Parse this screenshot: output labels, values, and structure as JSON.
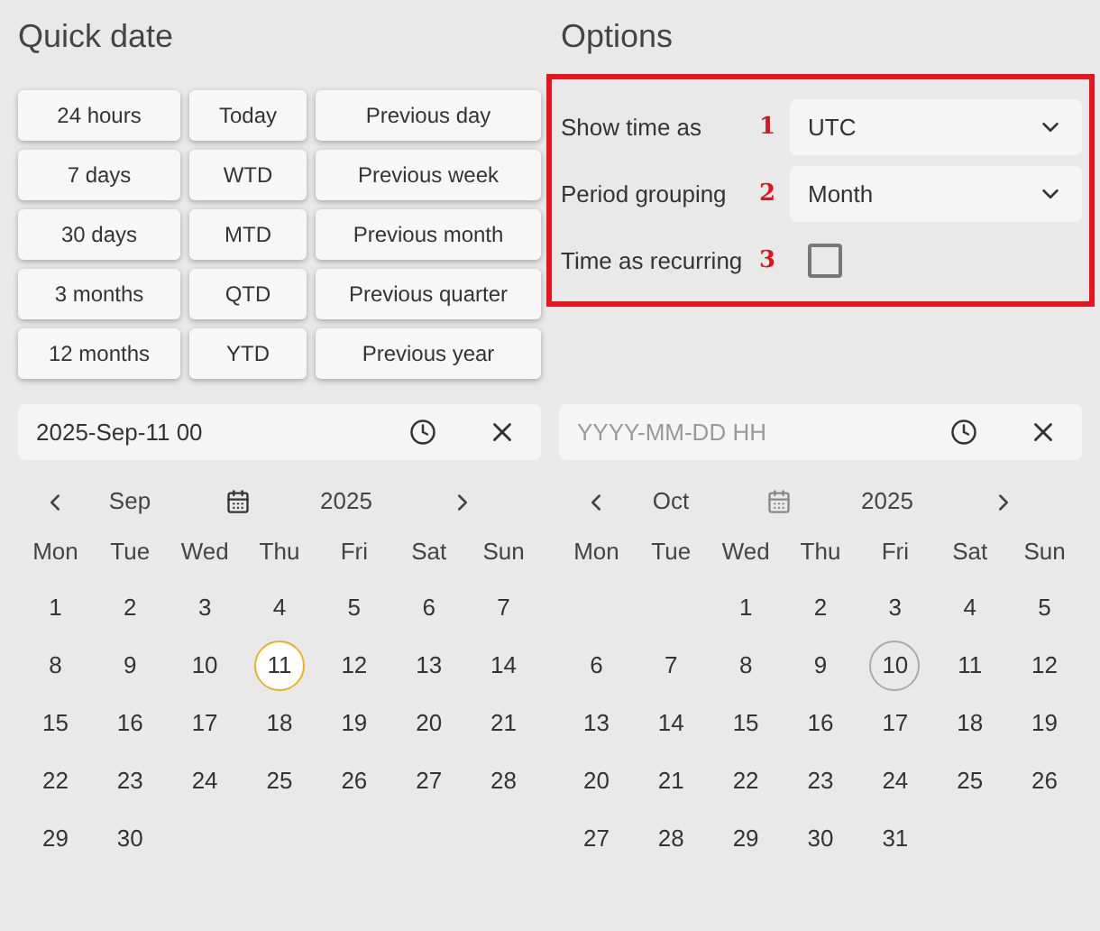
{
  "quick_date": {
    "title": "Quick date",
    "buttons": [
      {
        "label": "24 hours"
      },
      {
        "label": "Today"
      },
      {
        "label": "Previous day"
      },
      {
        "label": "7 days"
      },
      {
        "label": "WTD"
      },
      {
        "label": "Previous week"
      },
      {
        "label": "30 days"
      },
      {
        "label": "MTD"
      },
      {
        "label": "Previous month"
      },
      {
        "label": "3 months"
      },
      {
        "label": "QTD"
      },
      {
        "label": "Previous quarter"
      },
      {
        "label": "12 months"
      },
      {
        "label": "YTD"
      },
      {
        "label": "Previous year"
      }
    ]
  },
  "options": {
    "title": "Options",
    "rows": [
      {
        "kind": "select",
        "label": "Show time as",
        "annotation": "1",
        "value": "UTC"
      },
      {
        "kind": "select",
        "label": "Period grouping",
        "annotation": "2",
        "value": "Month"
      },
      {
        "kind": "checkbox",
        "label": "Time as recurring",
        "annotation": "3",
        "checked": false
      }
    ]
  },
  "calendars": [
    {
      "field": {
        "value": "2025-Sep-11 00"
      },
      "month": "Sep",
      "year": "2025",
      "weekdays": [
        "Mon",
        "Tue",
        "Wed",
        "Thu",
        "Fri",
        "Sat",
        "Sun"
      ],
      "days": [
        {
          "kind": "day",
          "label": "1",
          "selected": false,
          "today": false
        },
        {
          "kind": "day",
          "label": "2",
          "selected": false,
          "today": false
        },
        {
          "kind": "day",
          "label": "3",
          "selected": false,
          "today": false
        },
        {
          "kind": "day",
          "label": "4",
          "selected": false,
          "today": false
        },
        {
          "kind": "day",
          "label": "5",
          "selected": false,
          "today": false
        },
        {
          "kind": "day",
          "label": "6",
          "selected": false,
          "today": false
        },
        {
          "kind": "day",
          "label": "7",
          "selected": false,
          "today": false
        },
        {
          "kind": "day",
          "label": "8",
          "selected": false,
          "today": false
        },
        {
          "kind": "day",
          "label": "9",
          "selected": false,
          "today": false
        },
        {
          "kind": "day",
          "label": "10",
          "selected": false,
          "today": false
        },
        {
          "kind": "day",
          "label": "11",
          "selected": true,
          "today": false
        },
        {
          "kind": "day",
          "label": "12",
          "selected": false,
          "today": false
        },
        {
          "kind": "day",
          "label": "13",
          "selected": false,
          "today": false
        },
        {
          "kind": "day",
          "label": "14",
          "selected": false,
          "today": false
        },
        {
          "kind": "day",
          "label": "15",
          "selected": false,
          "today": false
        },
        {
          "kind": "day",
          "label": "16",
          "selected": false,
          "today": false
        },
        {
          "kind": "day",
          "label": "17",
          "selected": false,
          "today": false
        },
        {
          "kind": "day",
          "label": "18",
          "selected": false,
          "today": false
        },
        {
          "kind": "day",
          "label": "19",
          "selected": false,
          "today": false
        },
        {
          "kind": "day",
          "label": "20",
          "selected": false,
          "today": false
        },
        {
          "kind": "day",
          "label": "21",
          "selected": false,
          "today": false
        },
        {
          "kind": "day",
          "label": "22",
          "selected": false,
          "today": false
        },
        {
          "kind": "day",
          "label": "23",
          "selected": false,
          "today": false
        },
        {
          "kind": "day",
          "label": "24",
          "selected": false,
          "today": false
        },
        {
          "kind": "day",
          "label": "25",
          "selected": false,
          "today": false
        },
        {
          "kind": "day",
          "label": "26",
          "selected": false,
          "today": false
        },
        {
          "kind": "day",
          "label": "27",
          "selected": false,
          "today": false
        },
        {
          "kind": "day",
          "label": "28",
          "selected": false,
          "today": false
        },
        {
          "kind": "day",
          "label": "29",
          "selected": false,
          "today": false
        },
        {
          "kind": "day",
          "label": "30",
          "selected": false,
          "today": false
        }
      ]
    },
    {
      "field": {
        "placeholder": "YYYY-MM-DD HH"
      },
      "month": "Oct",
      "year": "2025",
      "weekdays": [
        "Mon",
        "Tue",
        "Wed",
        "Thu",
        "Fri",
        "Sat",
        "Sun"
      ],
      "days": [
        {
          "kind": "blank"
        },
        {
          "kind": "blank"
        },
        {
          "kind": "day",
          "label": "1",
          "selected": false,
          "today": false
        },
        {
          "kind": "day",
          "label": "2",
          "selected": false,
          "today": false
        },
        {
          "kind": "day",
          "label": "3",
          "selected": false,
          "today": false
        },
        {
          "kind": "day",
          "label": "4",
          "selected": false,
          "today": false
        },
        {
          "kind": "day",
          "label": "5",
          "selected": false,
          "today": false
        },
        {
          "kind": "day",
          "label": "6",
          "selected": false,
          "today": false
        },
        {
          "kind": "day",
          "label": "7",
          "selected": false,
          "today": false
        },
        {
          "kind": "day",
          "label": "8",
          "selected": false,
          "today": false
        },
        {
          "kind": "day",
          "label": "9",
          "selected": false,
          "today": false
        },
        {
          "kind": "day",
          "label": "10",
          "selected": false,
          "today": true
        },
        {
          "kind": "day",
          "label": "11",
          "selected": false,
          "today": false
        },
        {
          "kind": "day",
          "label": "12",
          "selected": false,
          "today": false
        },
        {
          "kind": "day",
          "label": "13",
          "selected": false,
          "today": false
        },
        {
          "kind": "day",
          "label": "14",
          "selected": false,
          "today": false
        },
        {
          "kind": "day",
          "label": "15",
          "selected": false,
          "today": false
        },
        {
          "kind": "day",
          "label": "16",
          "selected": false,
          "today": false
        },
        {
          "kind": "day",
          "label": "17",
          "selected": false,
          "today": false
        },
        {
          "kind": "day",
          "label": "18",
          "selected": false,
          "today": false
        },
        {
          "kind": "day",
          "label": "19",
          "selected": false,
          "today": false
        },
        {
          "kind": "day",
          "label": "20",
          "selected": false,
          "today": false
        },
        {
          "kind": "day",
          "label": "21",
          "selected": false,
          "today": false
        },
        {
          "kind": "day",
          "label": "22",
          "selected": false,
          "today": false
        },
        {
          "kind": "day",
          "label": "23",
          "selected": false,
          "today": false
        },
        {
          "kind": "day",
          "label": "24",
          "selected": false,
          "today": false
        },
        {
          "kind": "day",
          "label": "25",
          "selected": false,
          "today": false
        },
        {
          "kind": "day",
          "label": "26",
          "selected": false,
          "today": false
        },
        {
          "kind": "day",
          "label": "27",
          "selected": false,
          "today": false
        },
        {
          "kind": "day",
          "label": "28",
          "selected": false,
          "today": false
        },
        {
          "kind": "day",
          "label": "29",
          "selected": false,
          "today": false
        },
        {
          "kind": "day",
          "label": "30",
          "selected": false,
          "today": false
        },
        {
          "kind": "day",
          "label": "31",
          "selected": false,
          "today": false
        }
      ]
    }
  ]
}
